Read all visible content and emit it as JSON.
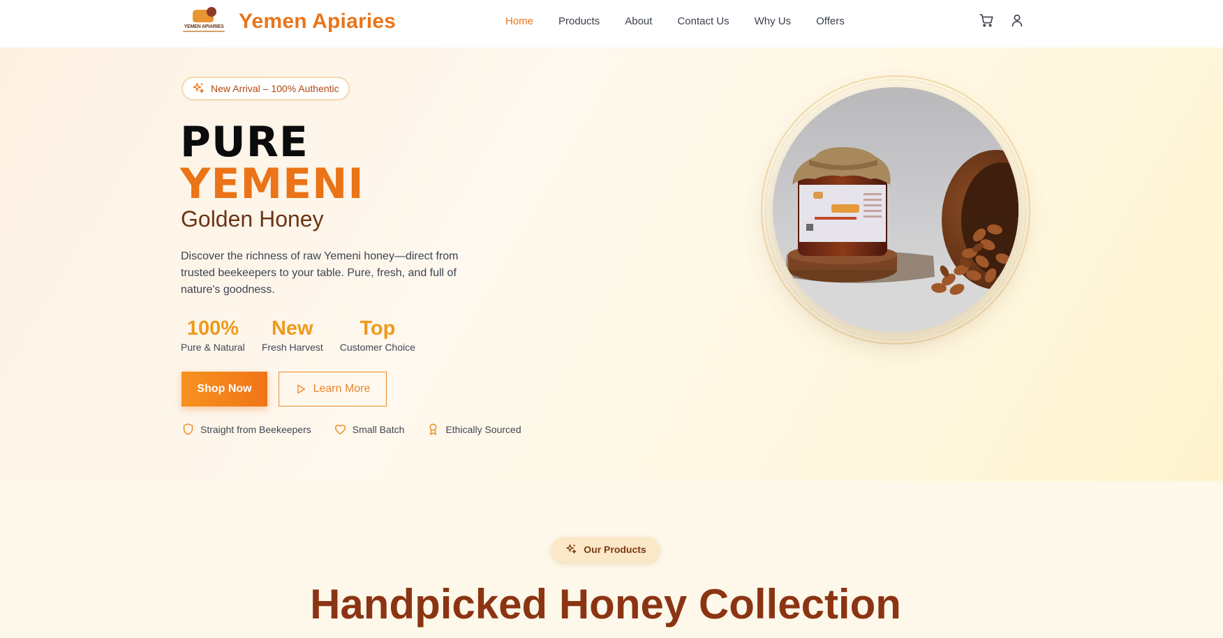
{
  "brand": {
    "logo_text": "YEMEN APIARIES",
    "name": "Yemen Apiaries"
  },
  "nav": {
    "links": [
      {
        "label": "Home",
        "active": true
      },
      {
        "label": "Products",
        "active": false
      },
      {
        "label": "About",
        "active": false
      },
      {
        "label": "Contact Us",
        "active": false
      },
      {
        "label": "Why Us",
        "active": false
      },
      {
        "label": "Offers",
        "active": false
      }
    ],
    "icons": [
      "cart-icon",
      "user-icon"
    ]
  },
  "hero": {
    "badge": "New Arrival – 100% Authentic",
    "title_line1": "PURE",
    "title_line2": "YEMENI",
    "subtitle": "Golden Honey",
    "description": "Discover the richness of raw Yemeni honey—direct from trusted beekeepers to your table. Pure, fresh, and full of nature's goodness.",
    "stats": [
      {
        "value": "100%",
        "label": "Pure & Natural"
      },
      {
        "value": "New",
        "label": "Fresh Harvest"
      },
      {
        "value": "Top",
        "label": "Customer Choice"
      }
    ],
    "primary_button": "Shop Now",
    "secondary_button": "Learn More",
    "trust": [
      {
        "icon": "shield-icon",
        "label": "Straight from Beekeepers"
      },
      {
        "icon": "heart-icon",
        "label": "Small Batch"
      },
      {
        "icon": "award-icon",
        "label": "Ethically Sourced"
      }
    ]
  },
  "products": {
    "badge": "Our Products",
    "title": "Handpicked Honey Collection"
  },
  "colors": {
    "accent": "#e8751a",
    "stat": "#ef9a1c",
    "dark_brown": "#8b3413"
  }
}
